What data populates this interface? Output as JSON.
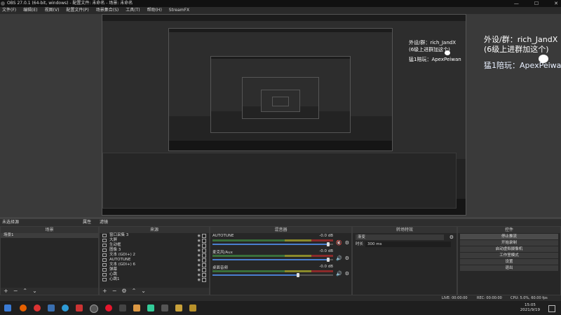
{
  "window": {
    "title": "OBS 27.0.1 (64-bit, windows) - 配置文件: 未命名 - 场景: 未命名",
    "minimize": "—",
    "maximize": "☐",
    "close": "✕"
  },
  "menu": [
    "文件(F)",
    "编辑(E)",
    "视图(V)",
    "配置文件(P)",
    "场景集合(S)",
    "工具(T)",
    "帮助(H)",
    "StreamFX"
  ],
  "overlay": {
    "line1": "外设/群：rich_JandX",
    "line2": "(6级上进群加这个)",
    "line3": "猛1陪玩：ApexPeiwan"
  },
  "scene_bar": {
    "label": "未选择源",
    "props": "属性",
    "filters": "滤镜"
  },
  "panels": {
    "scenes": {
      "title": "场景",
      "items": [
        "场景1"
      ]
    },
    "sources": {
      "title": "来源",
      "items": [
        "窗口采集 3",
        "大屏",
        "生动框",
        "图像 3",
        "文本 (GDI+) 2",
        "AUTOTUNE",
        "文本 (GDI+) 6",
        "弹幕",
        "心跳",
        "心跳1"
      ]
    },
    "mixer": {
      "title": "混音器",
      "channels": [
        {
          "name": "AUTOTUNE",
          "db": "-0.0 dB"
        },
        {
          "name": "麦克风/Aux",
          "db": "-0.0 dB"
        },
        {
          "name": "桌面音频",
          "db": "-0.0 dB"
        }
      ]
    },
    "transitions": {
      "title": "转场特效",
      "type": "渐变",
      "duration_label": "时长",
      "duration": "300 ms"
    },
    "controls": {
      "title": "控件",
      "buttons": [
        "停止推流",
        "开始录制",
        "启动虚拟摄像机",
        "工作室模式",
        "设置",
        "退出"
      ]
    }
  },
  "status": {
    "live": "LIVE: 00:00:00",
    "rec": "REC: 00:00:00",
    "cpu": "CPU: 5.0%, 60.00 fps"
  },
  "clock": {
    "time": "15:05",
    "date": "2021/9/19"
  },
  "colors": {
    "accent": "#4a7fd0",
    "meter_green": "#3a6f3a",
    "meter_yellow": "#8a8a2a",
    "meter_red": "#8a2a2a"
  },
  "icons": [
    "windows-start-icon",
    "firefox-icon",
    "chrome-icon",
    "folder-icon",
    "obs-icon",
    "weibo-icon",
    "steam-icon",
    "apex-icon"
  ]
}
